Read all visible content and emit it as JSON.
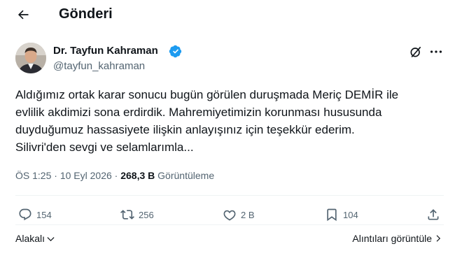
{
  "header": {
    "title": "Gönderi"
  },
  "author": {
    "name": "Dr. Tayfun Kahraman",
    "handle": "@tayfun_kahraman"
  },
  "tweet": {
    "text": "Aldığımız ortak karar sonucu bugün görülen duruşmada Meriç DEMİR ile\nevlilik akdimizi sona erdirdik. Mahremiyetimizin korunması hususunda\nduyduğumuz hassasiyete ilişkin anlayışınız için teşekkür ederim.\nSilivri'den sevgi ve selamlarımla..."
  },
  "meta": {
    "time": "ÖS 1:25",
    "sep1": " · ",
    "date": "10 Eyl 2026",
    "sep2": " · ",
    "views_count": "268,3 B",
    "views_label": " Görüntüleme"
  },
  "actions": {
    "replies": "154",
    "reposts": "256",
    "likes": "2 B",
    "bookmarks": "104"
  },
  "footer": {
    "sort_label": "Alakalı",
    "quotes_label": "Alıntıları görüntüle"
  },
  "colors": {
    "verified": "#1d9bf0",
    "text": "#0f1419",
    "secondary": "#536471",
    "divider": "#eff3f4"
  },
  "icons": {
    "back": "arrow-left-icon",
    "verified": "verified-badge-icon",
    "grok": "grok-icon",
    "more": "more-icon",
    "reply": "reply-icon",
    "repost": "repost-icon",
    "like": "heart-icon",
    "bookmark": "bookmark-icon",
    "share": "share-icon",
    "sort": "chevron-down-icon",
    "quotes": "chevron-right-icon"
  }
}
